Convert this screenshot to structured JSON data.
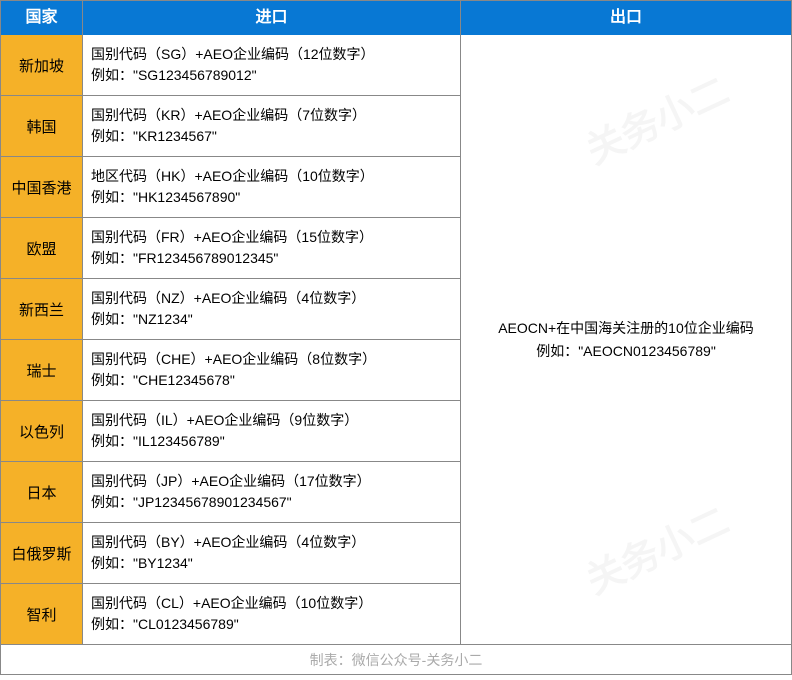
{
  "headers": {
    "country": "国家",
    "import": "进口",
    "export": "出口"
  },
  "rows": [
    {
      "country": "新加坡",
      "import_line1": "国别代码（SG）+AEO企业编码（12位数字）",
      "import_line2": "例如：\"SG123456789012\""
    },
    {
      "country": "韩国",
      "import_line1": "国别代码（KR）+AEO企业编码（7位数字）",
      "import_line2": "例如：\"KR1234567\""
    },
    {
      "country": "中国香港",
      "import_line1": "地区代码（HK）+AEO企业编码（10位数字）",
      "import_line2": "例如：\"HK1234567890\""
    },
    {
      "country": "欧盟",
      "import_line1": "国别代码（FR）+AEO企业编码（15位数字）",
      "import_line2": "例如：\"FR123456789012345\""
    },
    {
      "country": "新西兰",
      "import_line1": "国别代码（NZ）+AEO企业编码（4位数字）",
      "import_line2": "例如：\"NZ1234\""
    },
    {
      "country": "瑞士",
      "import_line1": "国别代码（CHE）+AEO企业编码（8位数字）",
      "import_line2": "例如：\"CHE12345678\""
    },
    {
      "country": "以色列",
      "import_line1": "国别代码（IL）+AEO企业编码（9位数字）",
      "import_line2": "例如：\"IL123456789\""
    },
    {
      "country": "日本",
      "import_line1": "国别代码（JP）+AEO企业编码（17位数字）",
      "import_line2": "例如：\"JP12345678901234567\""
    },
    {
      "country": "白俄罗斯",
      "import_line1": "国别代码（BY）+AEO企业编码（4位数字）",
      "import_line2": "例如：\"BY1234\""
    },
    {
      "country": "智利",
      "import_line1": "国别代码（CL）+AEO企业编码（10位数字）",
      "import_line2": "例如：\"CL0123456789\""
    }
  ],
  "export": {
    "line1": "AEOCN+在中国海关注册的10位企业编码",
    "line2": "例如：\"AEOCN0123456789\""
  },
  "footer": "制表：微信公众号-关务小二",
  "watermark": "关务小二"
}
